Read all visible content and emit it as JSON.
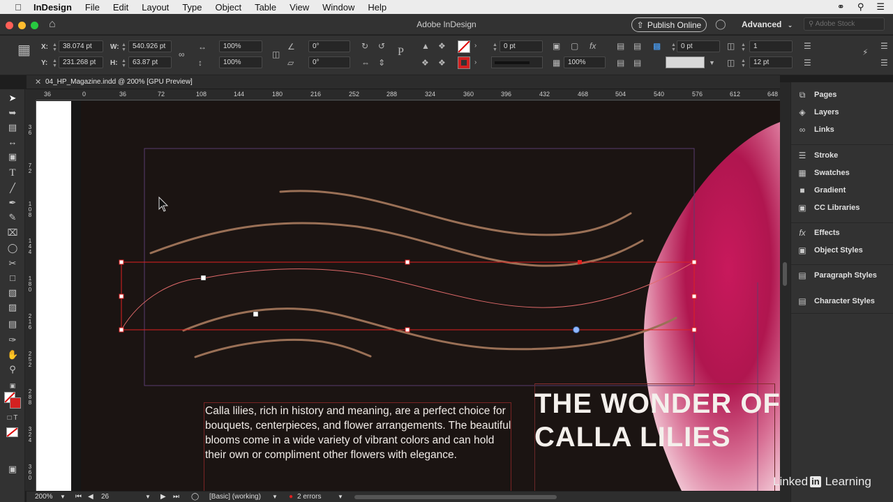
{
  "menubar": {
    "apple_icon": "apple-icon",
    "items": [
      "InDesign",
      "File",
      "Edit",
      "Layout",
      "Type",
      "Object",
      "Table",
      "View",
      "Window",
      "Help"
    ],
    "right_icons": [
      "creative-cloud-icon",
      "search-icon",
      "list-icon"
    ]
  },
  "window": {
    "title": "Adobe InDesign",
    "publish_label": "Publish Online",
    "workspace_label": "Advanced",
    "stock_placeholder": "Adobe Stock"
  },
  "control": {
    "x_label": "X:",
    "x_value": "38.074 pt",
    "y_label": "Y:",
    "y_value": "231.268 pt",
    "w_label": "W:",
    "w_value": "540.926 pt",
    "h_label": "H:",
    "h_value": "63.87 pt",
    "scale_x": "100%",
    "scale_y": "100%",
    "rotate": "0°",
    "shear": "0°",
    "stroke_weight": "0 pt",
    "opacity": "100%",
    "corner": "0 pt",
    "columns": "1",
    "gutter": "12 pt"
  },
  "document": {
    "tab_label": "04_HP_Magazine.indd @ 200% [GPU Preview]"
  },
  "ruler": {
    "h_ticks": [
      "36",
      "0",
      "36",
      "72",
      "108",
      "144",
      "180",
      "216",
      "252",
      "288",
      "324",
      "360",
      "396",
      "432",
      "468",
      "504",
      "540",
      "576",
      "612",
      "648"
    ],
    "v_ticks": [
      "3 6",
      "7 2",
      "1 0 8",
      "1 4 4",
      "1 8 0",
      "2 1 6",
      "2 5 2",
      "2 8 8",
      "3 2 4",
      "3 6 0"
    ]
  },
  "page": {
    "body_text": "Calla lilies, rich in history and meaning, are a perfect choice for bouquets, centerpieces, and flower arrangements. The beautiful blooms come in a wide variety of vibrant colors and can hold their own or compliment other flowers with elegance.",
    "headline": "THE WONDER OF CALLA LILIES",
    "accent_color": "#9a7056",
    "selection_color": "#e02020"
  },
  "status": {
    "zoom": "200%",
    "page_number": "26",
    "style": "[Basic] (working)",
    "errors": "2 errors"
  },
  "panels": {
    "group1": [
      {
        "label": "Pages",
        "icon": "pages-icon"
      },
      {
        "label": "Layers",
        "icon": "layers-icon"
      },
      {
        "label": "Links",
        "icon": "links-icon"
      }
    ],
    "group2": [
      {
        "label": "Stroke",
        "icon": "stroke-icon"
      },
      {
        "label": "Swatches",
        "icon": "swatches-icon"
      },
      {
        "label": "Gradient",
        "icon": "gradient-icon"
      },
      {
        "label": "CC Libraries",
        "icon": "cc-libraries-icon"
      }
    ],
    "group3": [
      {
        "label": "Effects",
        "icon": "effects-icon"
      },
      {
        "label": "Object Styles",
        "icon": "object-styles-icon"
      }
    ],
    "group4": [
      {
        "label": "Paragraph Styles",
        "icon": "paragraph-styles-icon"
      },
      {
        "label": "Character Styles",
        "icon": "character-styles-icon"
      }
    ]
  },
  "watermark": {
    "prefix": "Linked",
    "badge": "in",
    "suffix": "Learning"
  }
}
